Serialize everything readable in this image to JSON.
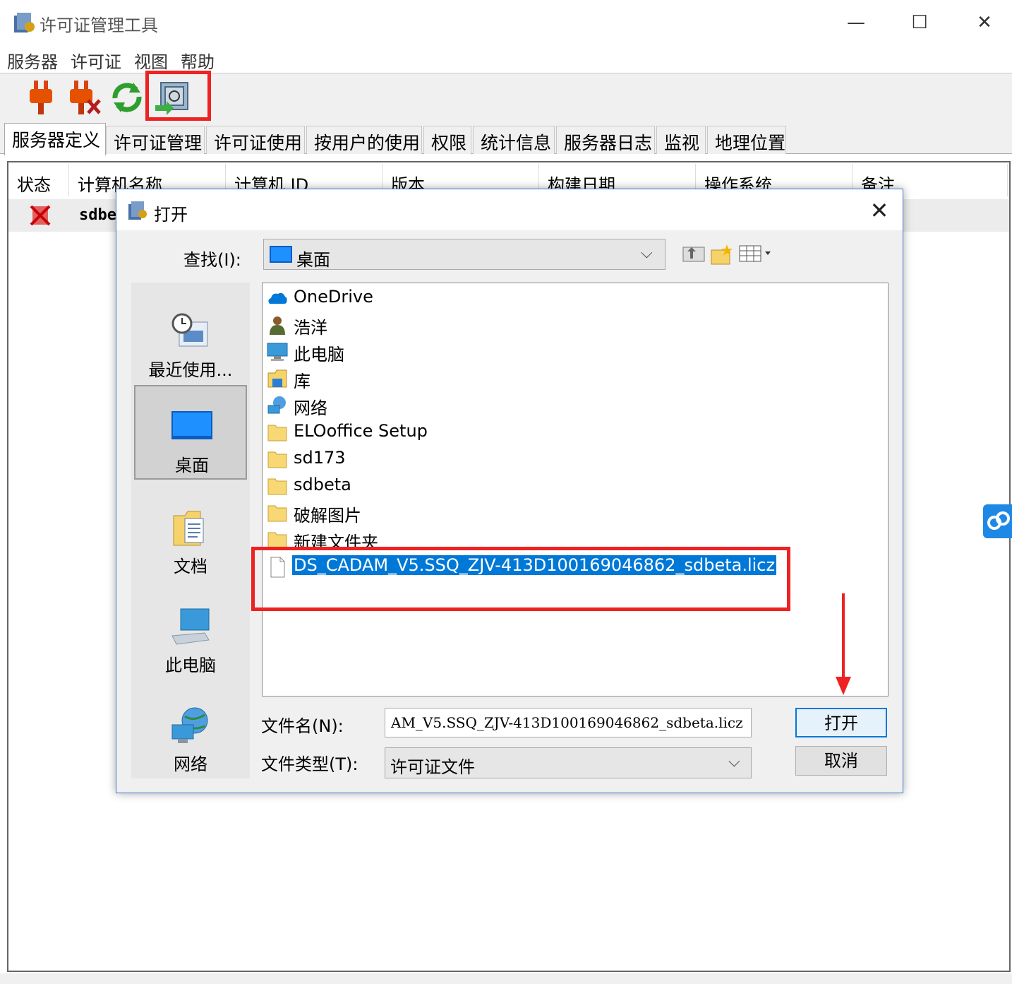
{
  "window": {
    "title": "许可证管理工具",
    "minimize": "—",
    "maximize": "☐",
    "close": "✕"
  },
  "menu": [
    "服务器",
    "许可证",
    "视图",
    "帮助"
  ],
  "toolbar": {
    "buttons": [
      "connect-plug-icon",
      "disconnect-plug-icon",
      "refresh-icon",
      "import-license-icon"
    ]
  },
  "tabs": [
    "服务器定义",
    "许可证管理",
    "许可证使用",
    "按用户的使用",
    "权限",
    "统计信息",
    "服务器日志",
    "监视",
    "地理位置"
  ],
  "table": {
    "columns": [
      "状态",
      "计算机名称",
      "计算机 ID",
      "版本",
      "构建日期",
      "操作系统",
      "备注"
    ],
    "rows": [
      {
        "computer_name": "sdbe"
      }
    ]
  },
  "dialog": {
    "title": "打开",
    "close": "✕",
    "look_in_label": "查找(I):",
    "look_in_value": "桌面",
    "places": [
      "最近使用...",
      "桌面",
      "文档",
      "此电脑",
      "网络"
    ],
    "files": [
      {
        "name": "OneDrive",
        "icon": "onedrive-icon"
      },
      {
        "name": "浩洋",
        "icon": "user-icon"
      },
      {
        "name": "此电脑",
        "icon": "computer-icon"
      },
      {
        "name": "库",
        "icon": "library-icon"
      },
      {
        "name": "网络",
        "icon": "network-icon"
      },
      {
        "name": "ELOoffice Setup",
        "icon": "folder-icon"
      },
      {
        "name": "sd173",
        "icon": "folder-icon"
      },
      {
        "name": "sdbeta",
        "icon": "folder-icon"
      },
      {
        "name": "破解图片",
        "icon": "folder-icon"
      },
      {
        "name": "新建文件夹",
        "icon": "folder-icon"
      },
      {
        "name": "DS_CADAM_V5.SSQ_ZJV-413D100169046862_sdbeta.licz",
        "icon": "file-icon",
        "selected": true
      }
    ],
    "filename_label": "文件名(N):",
    "filename_value": "AM_V5.SSQ_ZJV-413D100169046862_sdbeta.licz",
    "filetype_label": "文件类型(T):",
    "filetype_value": "许可证文件",
    "open_button": "打开",
    "cancel_button": "取消"
  },
  "colors": {
    "accent": "#0078d7",
    "annotation": "#ee2222"
  }
}
